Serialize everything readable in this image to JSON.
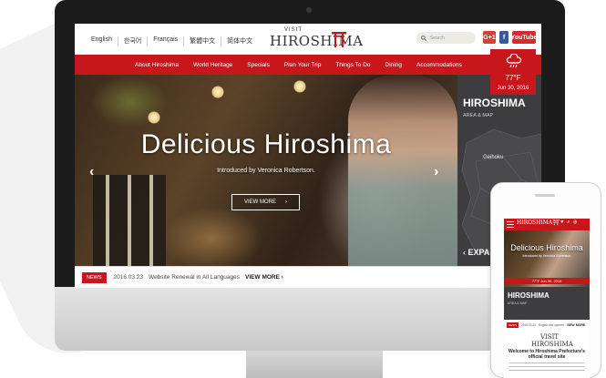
{
  "site": {
    "languages": [
      "English",
      "한국어",
      "Français",
      "繁體中文",
      "简体中文"
    ],
    "logo_visit": "VISIT",
    "logo_name": "HIROSHIMA",
    "search_placeholder": "Search",
    "social": {
      "gplus": "G+1",
      "facebook": "f",
      "youtube": "YouTube"
    }
  },
  "nav": {
    "items": [
      "About Hiroshima",
      "World Heritage",
      "Specials",
      "Plan Your Trip",
      "Things To Do",
      "Dining",
      "Accommodations"
    ]
  },
  "weather": {
    "temp": "77°F",
    "date": "Jun 30, 2016"
  },
  "hero": {
    "title": "Delicious Hiroshima",
    "subtitle": "Introduced by Veronica Robertson.",
    "button": "VIEW MORE",
    "button_arrow": "›",
    "prev": "‹",
    "next": "›"
  },
  "map_panel": {
    "title": "HIROSHIMA",
    "subtitle": "AREA & MAP",
    "region": "Geihoku",
    "expand": "‹  EXPAN"
  },
  "news": {
    "tag": "NEWS",
    "date": "2016.03.23",
    "text": "Website Renewal in All Languages",
    "more": "VIEW MORE  ›"
  },
  "phone": {
    "logo": "HIROSHIMA⛩",
    "icons": "♥ ⌕ ⊕",
    "hero_title": "Delicious Hiroshima",
    "hero_sub": "Introduced by Veronica Robertson",
    "weather": "77°F  Jun 30, 2016",
    "map_title": "HIROSHIMA",
    "map_sub": "AREA & MAP",
    "news_tag": "NEWS",
    "news_date": "2016.03.23",
    "news_text": "English site opened",
    "news_more": "VIEW MORE",
    "logo2": "VISIT HIROSHIMA",
    "welcome": "Welcome to Hiroshima Prefecture's official travel site"
  }
}
